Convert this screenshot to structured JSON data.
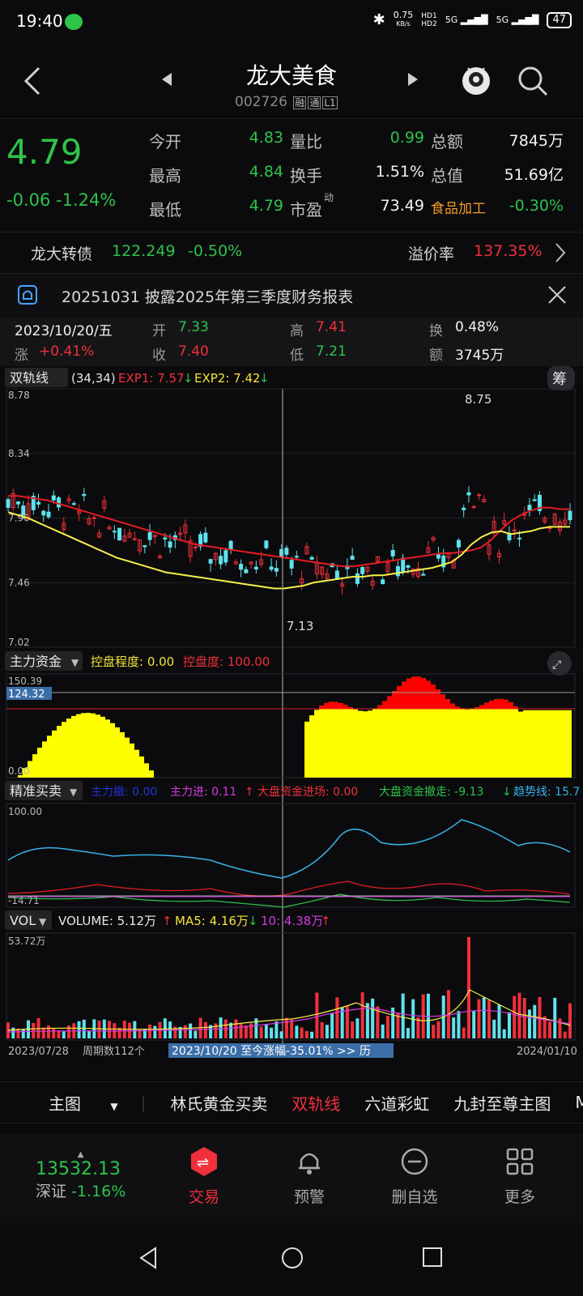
{
  "status": {
    "time": "19:40",
    "net_speed": "0.75",
    "net_unit": "KB/s",
    "hd1": "HD1",
    "hd2": "HD2",
    "sig1": "5G",
    "sig2": "5G",
    "battery": "47"
  },
  "header": {
    "name": "龙大美食",
    "code": "002726",
    "tags": [
      "融",
      "通",
      "L1"
    ]
  },
  "quote": {
    "price": "4.79",
    "change": "-0.06",
    "change_pct": "-1.24%",
    "fields": [
      {
        "label": "今开",
        "value": "4.83",
        "color": "green"
      },
      {
        "label": "量比",
        "value": "0.99",
        "color": "green"
      },
      {
        "label": "总额",
        "value": "7845万",
        "color": "white"
      },
      {
        "label": "最高",
        "value": "4.84",
        "color": "green"
      },
      {
        "label": "换手",
        "value": "1.51%",
        "color": "white"
      },
      {
        "label": "总值",
        "value": "51.69亿",
        "color": "white"
      },
      {
        "label": "最低",
        "value": "4.79",
        "color": "green"
      },
      {
        "label": "市盈",
        "value": "73.49",
        "color": "white"
      },
      {
        "label": "食品加工",
        "value": "-0.30%",
        "color": "green"
      }
    ],
    "pe_sup": "动"
  },
  "convertible": {
    "name": "龙大转债",
    "price": "122.249",
    "pct": "-0.50%",
    "premium_label": "溢价率",
    "premium": "137.35%"
  },
  "notice": {
    "text": "20251031 披露2025年第三季度财务报表"
  },
  "day_info": {
    "date": "2023/10/20/五",
    "open_label": "开",
    "open": "7.33",
    "high_label": "高",
    "high": "7.41",
    "turn_label": "换",
    "turn": "0.48%",
    "chg_label": "涨",
    "chg": "+0.41%",
    "close_label": "收",
    "close": "7.40",
    "low_label": "低",
    "low": "7.21",
    "amt_label": "额",
    "amt": "3745万"
  },
  "main_chart": {
    "indicator": "双轨线",
    "params": "(34,34)",
    "exp1": "EXP1: 7.57",
    "exp2": "EXP2: 7.42",
    "chip_btn": "筹",
    "y_ticks": [
      "8.78",
      "8.34",
      "7.90",
      "7.46",
      "7.02"
    ],
    "high_mark": "8.75",
    "low_mark": "7.13",
    "ylim": [
      7.02,
      8.78
    ]
  },
  "fund_chart": {
    "indicator": "主力资金",
    "ctrl_degree": "控盘程度: 0.00",
    "ctrl": "控盘度: 100.00",
    "y_top": "150.39",
    "y_cursor": "124.32",
    "y_bottom": "0.00"
  },
  "trade_chart": {
    "indicator": "精准买卖",
    "main_out": "主力撤: 0.00",
    "main_in": "主力进: 0.11",
    "mkt_in": "大盘资金进场: 0.00",
    "mkt_out": "大盘资金撤走: -9.13",
    "trend": "趋势线: 15.7",
    "y_top": "100.00",
    "y_bottom": "-14.71"
  },
  "vol_chart": {
    "indicator": "VOL",
    "volume": "VOLUME: 5.12万",
    "ma5": "MA5: 4.16万",
    "ma10": "10: 4.38万",
    "y_top": "53.72万"
  },
  "footer_axis": {
    "start": "2023/07/28",
    "period": "周期数112个",
    "range_text": "2023/10/20 至今涨幅-35.01%  >> 历",
    "end": "2024/01/10"
  },
  "tabs": [
    "主图",
    "林氏黄金买卖",
    "双轨线",
    "六道彩虹",
    "九封至尊主图",
    "MA"
  ],
  "active_tab": "双轨线",
  "bottom_nav": {
    "index_value": "13532.13",
    "index_name": "深证",
    "index_pct": "-1.16%",
    "items": [
      "交易",
      "预警",
      "删自选",
      "更多"
    ]
  },
  "chart_data": {
    "type": "candlestick",
    "ylim": [
      7.02,
      8.78
    ],
    "exp1": [
      8.05,
      8.05,
      8.04,
      8.03,
      8.02,
      8.0,
      7.98,
      7.96,
      7.94,
      7.92,
      7.9,
      7.88,
      7.86,
      7.84,
      7.82,
      7.8,
      7.78,
      7.76,
      7.74,
      7.72,
      7.71,
      7.7,
      7.69,
      7.68,
      7.67,
      7.66,
      7.65,
      7.64,
      7.63,
      7.62,
      7.61,
      7.6,
      7.59,
      7.58,
      7.57,
      7.57,
      7.58,
      7.59,
      7.6,
      7.61,
      7.62,
      7.63,
      7.64,
      7.65,
      7.66,
      7.66,
      7.67,
      7.68,
      7.7,
      7.75,
      7.82,
      7.88,
      7.92,
      7.95,
      7.97,
      7.97,
      7.96,
      7.96
    ],
    "exp2": [
      7.94,
      7.92,
      7.9,
      7.87,
      7.84,
      7.81,
      7.78,
      7.75,
      7.72,
      7.69,
      7.66,
      7.63,
      7.61,
      7.59,
      7.57,
      7.55,
      7.53,
      7.52,
      7.51,
      7.5,
      7.49,
      7.48,
      7.47,
      7.46,
      7.45,
      7.44,
      7.43,
      7.42,
      7.42,
      7.43,
      7.44,
      7.46,
      7.47,
      7.48,
      7.49,
      7.5,
      7.5,
      7.51,
      7.51,
      7.52,
      7.53,
      7.54,
      7.55,
      7.56,
      7.58,
      7.6,
      7.65,
      7.72,
      7.77,
      7.8,
      7.81,
      7.79,
      7.8,
      7.81,
      7.83,
      7.84,
      7.84,
      7.84
    ]
  }
}
